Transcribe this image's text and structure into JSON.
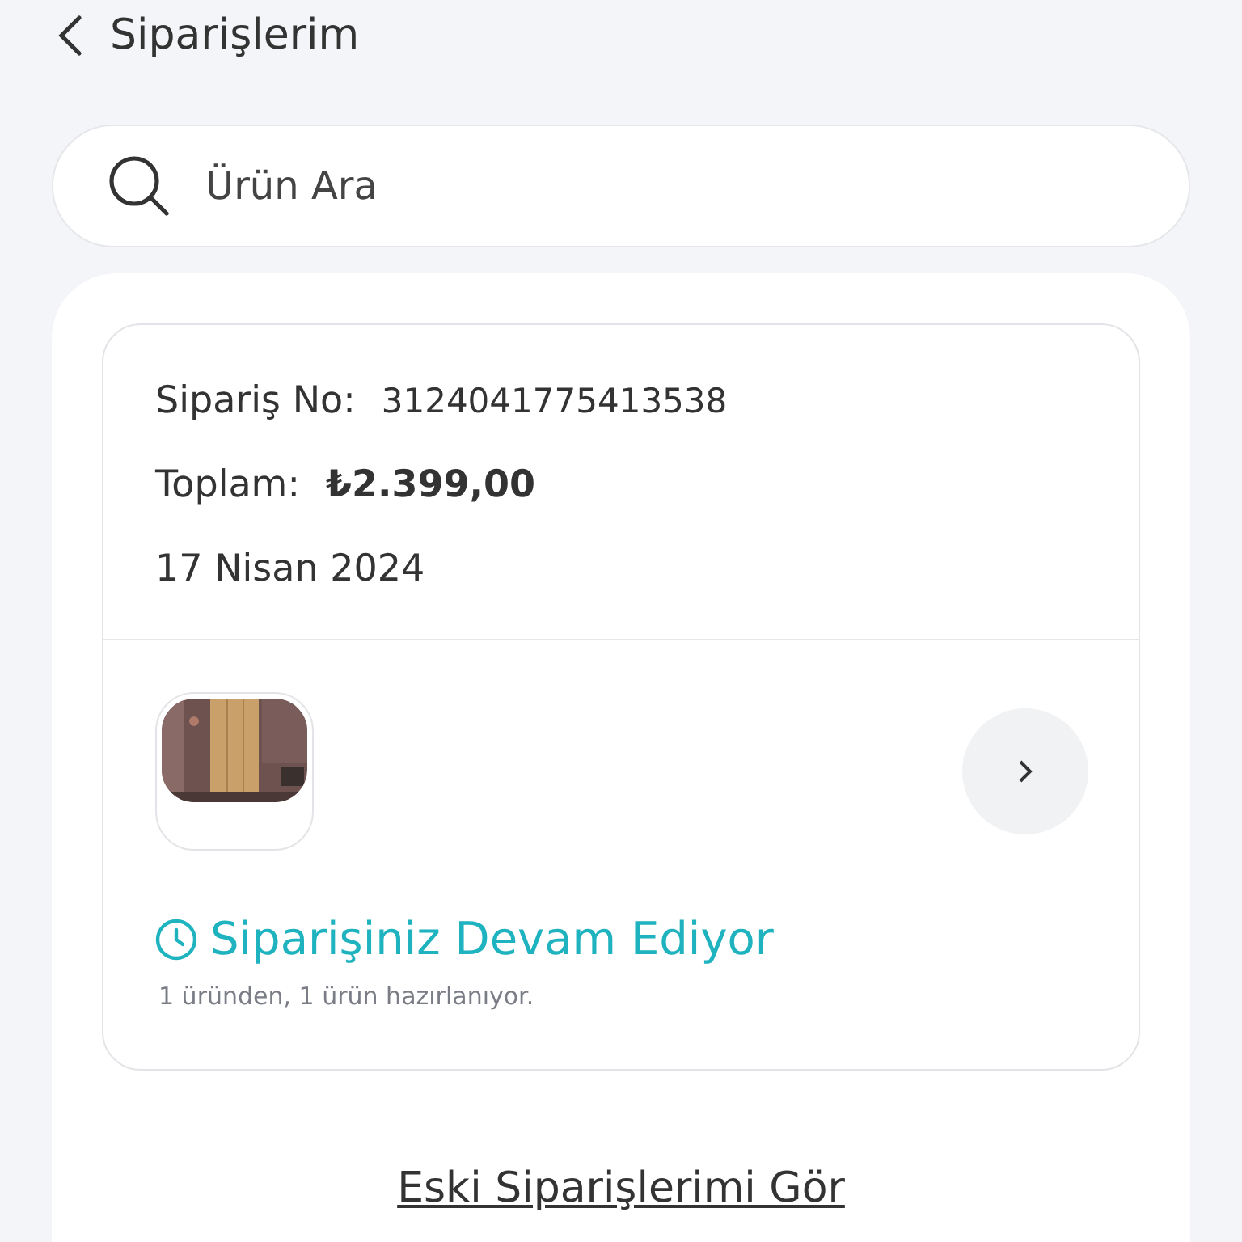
{
  "header": {
    "title": "Siparişlerim"
  },
  "search": {
    "placeholder": "Ürün Ara"
  },
  "order": {
    "number_label": "Sipariş No:",
    "number": "3124041775413538",
    "total_label": "Toplam:",
    "total": "₺2.399,00",
    "date": "17 Nisan 2024",
    "status": "Siparişiniz Devam Ediyor",
    "status_detail": "1 üründen, 1 ürün hazırlanıyor."
  },
  "old_orders_link": "Eski Siparişlerimi Gör"
}
